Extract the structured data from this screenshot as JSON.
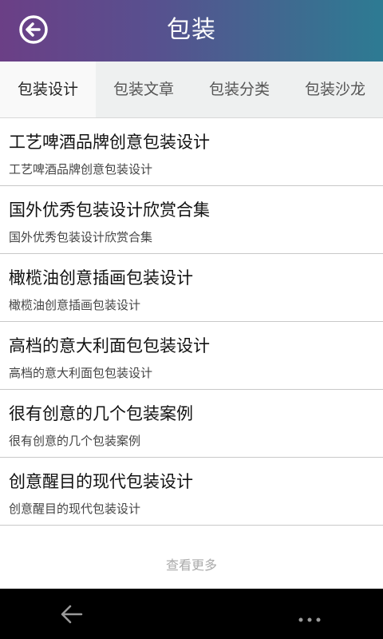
{
  "header": {
    "title": "包装",
    "back_icon": "back-circle-arrow-icon"
  },
  "tabs": [
    {
      "label": "包装设计",
      "active": true
    },
    {
      "label": "包装文章",
      "active": false
    },
    {
      "label": "包装分类",
      "active": false
    },
    {
      "label": "包装沙龙",
      "active": false
    }
  ],
  "articles": [
    {
      "title": "工艺啤酒品牌创意包装设计",
      "subtitle": "工艺啤酒品牌创意包装设计"
    },
    {
      "title": "国外优秀包装设计欣赏合集",
      "subtitle": "国外优秀包装设计欣赏合集"
    },
    {
      "title": "橄榄油创意插画包装设计",
      "subtitle": "橄榄油创意插画包装设计"
    },
    {
      "title": "高档的意大利面包包装设计",
      "subtitle": "高档的意大利面包包装设计"
    },
    {
      "title": "很有创意的几个包装案例",
      "subtitle": "很有创意的几个包装案例"
    },
    {
      "title": "创意醒目的现代包装设计",
      "subtitle": "创意醒目的现代包装设计"
    }
  ],
  "load_more": "查看更多",
  "colors": {
    "header_start": "#6b3f86",
    "header_end": "#2d7b93",
    "navbar": "#000000"
  }
}
